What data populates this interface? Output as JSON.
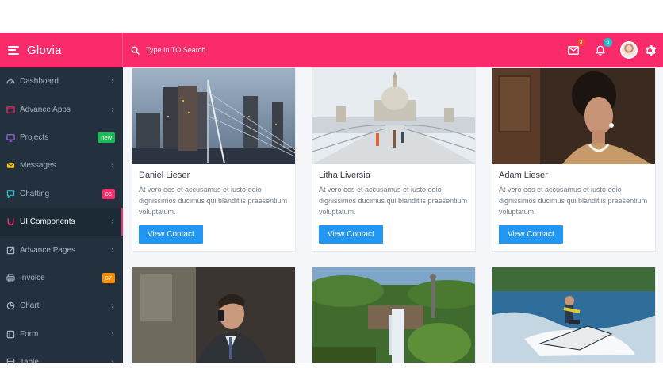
{
  "brand": {
    "name": "Glovia"
  },
  "search": {
    "placeholder": "Type In TO Search"
  },
  "topbar": {
    "mail_badge": "3",
    "notif_badge": "6",
    "colors": {
      "bar": "#fb2a6b",
      "mail_badge": "#f44336",
      "notif_badge": "#1ec6d1"
    }
  },
  "sidebar": {
    "items": [
      {
        "label": "Dashboard",
        "icon": "dashboard-icon",
        "chevron": "›"
      },
      {
        "label": "Advance Apps",
        "icon": "apps-icon",
        "chevron": "›"
      },
      {
        "label": "Projects",
        "icon": "projects-icon",
        "badge": "new",
        "badge_color": "#1db954"
      },
      {
        "label": "Messages",
        "icon": "messages-icon",
        "chevron": "›"
      },
      {
        "label": "Chatting",
        "icon": "chat-icon",
        "badge": "05",
        "badge_color": "#fb2a6b"
      },
      {
        "label": "UI Components",
        "icon": "ui-components-icon",
        "chevron": "›",
        "active": true
      },
      {
        "label": "Advance Pages",
        "icon": "pages-icon",
        "chevron": "›"
      },
      {
        "label": "Invoice",
        "icon": "invoice-icon",
        "badge": "07",
        "badge_color": "#ff8f00"
      },
      {
        "label": "Chart",
        "icon": "chart-icon",
        "chevron": "›"
      },
      {
        "label": "Form",
        "icon": "form-icon",
        "chevron": "›"
      },
      {
        "label": "Table",
        "icon": "table-icon",
        "chevron": "›"
      }
    ]
  },
  "cards": [
    {
      "name": "Daniel Lieser",
      "desc": "At vero eos et accusamus et iusto odio dignissimos ducimus qui blanditiis praesentium voluptatum.",
      "button": "View Contact",
      "image": "city-skyline-photo"
    },
    {
      "name": "Litha Liversia",
      "desc": "At vero eos et accusamus et iusto odio dignissimos ducimus qui blanditiis praesentium voluptatum.",
      "button": "View Contact",
      "image": "cathedral-bridge-photo"
    },
    {
      "name": "Adam Lieser",
      "desc": "At vero eos et accusamus et iusto odio dignissimos ducimus qui blanditiis praesentium voluptatum.",
      "button": "View Contact",
      "image": "woman-portrait-photo"
    },
    {
      "image": "businessman-phone-photo"
    },
    {
      "image": "waterfall-statue-photo"
    },
    {
      "image": "jetski-photo"
    }
  ],
  "colors": {
    "sidebar": "#22313d",
    "button": "#2196f3",
    "accent": "#fb2a6b"
  }
}
